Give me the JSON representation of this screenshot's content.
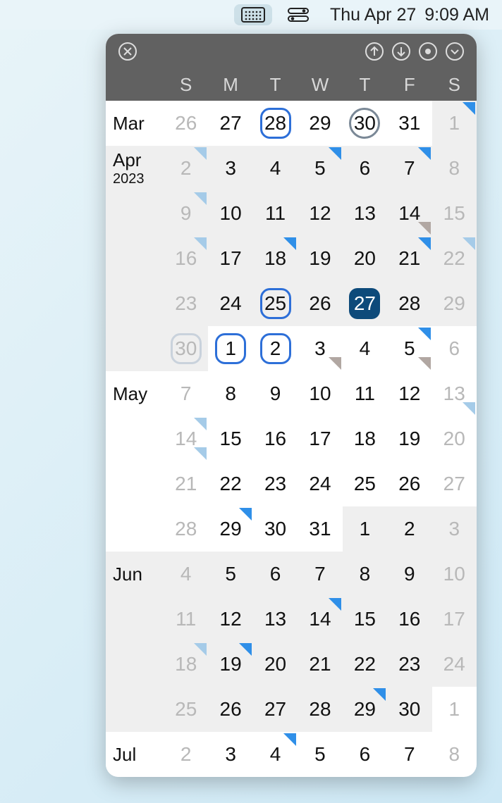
{
  "menubar": {
    "date": "Thu Apr 27",
    "time": "9:09 AM"
  },
  "dow": [
    "S",
    "M",
    "T",
    "W",
    "T",
    "F",
    "S"
  ],
  "rows": [
    {
      "month": "Mar",
      "year": "",
      "alt_month": false,
      "cells": [
        {
          "n": "26",
          "dim": true,
          "markers": []
        },
        {
          "n": "27",
          "dim": false,
          "markers": []
        },
        {
          "n": "28",
          "dim": false,
          "sel": "blue",
          "markers": []
        },
        {
          "n": "29",
          "dim": false,
          "markers": []
        },
        {
          "n": "30",
          "dim": false,
          "sel": "gray",
          "markers": []
        },
        {
          "n": "31",
          "dim": false,
          "markers": []
        },
        {
          "n": "1",
          "dim": true,
          "alt": true,
          "markers": [
            "blue"
          ]
        }
      ]
    },
    {
      "month": "Apr",
      "year": "2023",
      "alt_month": true,
      "cells": [
        {
          "n": "2",
          "dim": true,
          "alt": true,
          "markers": [
            "light"
          ]
        },
        {
          "n": "3",
          "dim": false,
          "alt": true,
          "markers": []
        },
        {
          "n": "4",
          "dim": false,
          "alt": true,
          "markers": []
        },
        {
          "n": "5",
          "dim": false,
          "alt": true,
          "markers": [
            "blue"
          ]
        },
        {
          "n": "6",
          "dim": false,
          "alt": true,
          "markers": []
        },
        {
          "n": "7",
          "dim": false,
          "alt": true,
          "markers": [
            "blue"
          ]
        },
        {
          "n": "8",
          "dim": true,
          "alt": true,
          "markers": []
        }
      ]
    },
    {
      "month": "",
      "year": "",
      "alt_month": true,
      "cells": [
        {
          "n": "9",
          "dim": true,
          "alt": true,
          "markers": [
            "light"
          ]
        },
        {
          "n": "10",
          "dim": false,
          "alt": true,
          "markers": []
        },
        {
          "n": "11",
          "dim": false,
          "alt": true,
          "markers": []
        },
        {
          "n": "12",
          "dim": false,
          "alt": true,
          "markers": []
        },
        {
          "n": "13",
          "dim": false,
          "alt": true,
          "markers": []
        },
        {
          "n": "14",
          "dim": false,
          "alt": true,
          "markers": [],
          "br": "gray"
        },
        {
          "n": "15",
          "dim": true,
          "alt": true,
          "markers": []
        }
      ]
    },
    {
      "month": "",
      "year": "",
      "alt_month": true,
      "cells": [
        {
          "n": "16",
          "dim": true,
          "alt": true,
          "markers": [
            "light"
          ]
        },
        {
          "n": "17",
          "dim": false,
          "alt": true,
          "markers": []
        },
        {
          "n": "18",
          "dim": false,
          "alt": true,
          "markers": [
            "blue"
          ]
        },
        {
          "n": "19",
          "dim": false,
          "alt": true,
          "markers": []
        },
        {
          "n": "20",
          "dim": false,
          "alt": true,
          "markers": []
        },
        {
          "n": "21",
          "dim": false,
          "alt": true,
          "markers": [
            "blue"
          ]
        },
        {
          "n": "22",
          "dim": true,
          "alt": true,
          "markers": [
            "light"
          ]
        }
      ]
    },
    {
      "month": "",
      "year": "",
      "alt_month": true,
      "cells": [
        {
          "n": "23",
          "dim": true,
          "alt": true,
          "markers": []
        },
        {
          "n": "24",
          "dim": false,
          "alt": true,
          "markers": []
        },
        {
          "n": "25",
          "dim": false,
          "alt": true,
          "sel": "blue",
          "markers": []
        },
        {
          "n": "26",
          "dim": false,
          "alt": true,
          "markers": []
        },
        {
          "n": "27",
          "dim": false,
          "alt": true,
          "today": true,
          "markers": []
        },
        {
          "n": "28",
          "dim": false,
          "alt": true,
          "markers": []
        },
        {
          "n": "29",
          "dim": true,
          "alt": true,
          "markers": []
        }
      ]
    },
    {
      "month": "",
      "year": "",
      "alt_month": true,
      "cells": [
        {
          "n": "30",
          "dim": true,
          "alt": true,
          "sel": "light",
          "markers": []
        },
        {
          "n": "1",
          "dim": false,
          "alt": false,
          "sel": "blue",
          "markers": []
        },
        {
          "n": "2",
          "dim": false,
          "alt": false,
          "sel": "blue",
          "markers": []
        },
        {
          "n": "3",
          "dim": false,
          "alt": false,
          "markers": [],
          "br": "gray"
        },
        {
          "n": "4",
          "dim": false,
          "alt": false,
          "markers": []
        },
        {
          "n": "5",
          "dim": false,
          "alt": false,
          "markers": [
            "blue"
          ],
          "br": "gray"
        },
        {
          "n": "6",
          "dim": true,
          "alt": false,
          "markers": []
        }
      ]
    },
    {
      "month": "May",
      "year": "",
      "alt_month": false,
      "cells": [
        {
          "n": "7",
          "dim": true,
          "markers": []
        },
        {
          "n": "8",
          "dim": false,
          "markers": []
        },
        {
          "n": "9",
          "dim": false,
          "markers": []
        },
        {
          "n": "10",
          "dim": false,
          "markers": []
        },
        {
          "n": "11",
          "dim": false,
          "markers": []
        },
        {
          "n": "12",
          "dim": false,
          "markers": []
        },
        {
          "n": "13",
          "dim": true,
          "markers": [],
          "br": "light"
        }
      ]
    },
    {
      "month": "",
      "year": "",
      "alt_month": false,
      "cells": [
        {
          "n": "14",
          "dim": true,
          "markers": [
            "light"
          ],
          "br": "light"
        },
        {
          "n": "15",
          "dim": false,
          "markers": []
        },
        {
          "n": "16",
          "dim": false,
          "markers": []
        },
        {
          "n": "17",
          "dim": false,
          "markers": []
        },
        {
          "n": "18",
          "dim": false,
          "markers": []
        },
        {
          "n": "19",
          "dim": false,
          "markers": []
        },
        {
          "n": "20",
          "dim": true,
          "markers": []
        }
      ]
    },
    {
      "month": "",
      "year": "",
      "alt_month": false,
      "cells": [
        {
          "n": "21",
          "dim": true,
          "markers": []
        },
        {
          "n": "22",
          "dim": false,
          "markers": []
        },
        {
          "n": "23",
          "dim": false,
          "markers": []
        },
        {
          "n": "24",
          "dim": false,
          "markers": []
        },
        {
          "n": "25",
          "dim": false,
          "markers": []
        },
        {
          "n": "26",
          "dim": false,
          "markers": []
        },
        {
          "n": "27",
          "dim": true,
          "markers": []
        }
      ]
    },
    {
      "month": "",
      "year": "",
      "alt_month": false,
      "cells": [
        {
          "n": "28",
          "dim": true,
          "markers": []
        },
        {
          "n": "29",
          "dim": false,
          "markers": [
            "blue"
          ]
        },
        {
          "n": "30",
          "dim": false,
          "markers": []
        },
        {
          "n": "31",
          "dim": false,
          "markers": []
        },
        {
          "n": "1",
          "dim": false,
          "alt": true,
          "markers": []
        },
        {
          "n": "2",
          "dim": false,
          "alt": true,
          "markers": []
        },
        {
          "n": "3",
          "dim": true,
          "alt": true,
          "markers": []
        }
      ]
    },
    {
      "month": "Jun",
      "year": "",
      "alt_month": true,
      "cells": [
        {
          "n": "4",
          "dim": true,
          "alt": true,
          "markers": []
        },
        {
          "n": "5",
          "dim": false,
          "alt": true,
          "markers": []
        },
        {
          "n": "6",
          "dim": false,
          "alt": true,
          "markers": []
        },
        {
          "n": "7",
          "dim": false,
          "alt": true,
          "markers": []
        },
        {
          "n": "8",
          "dim": false,
          "alt": true,
          "markers": []
        },
        {
          "n": "9",
          "dim": false,
          "alt": true,
          "markers": []
        },
        {
          "n": "10",
          "dim": true,
          "alt": true,
          "markers": []
        }
      ]
    },
    {
      "month": "",
      "year": "",
      "alt_month": true,
      "cells": [
        {
          "n": "11",
          "dim": true,
          "alt": true,
          "markers": []
        },
        {
          "n": "12",
          "dim": false,
          "alt": true,
          "markers": []
        },
        {
          "n": "13",
          "dim": false,
          "alt": true,
          "markers": []
        },
        {
          "n": "14",
          "dim": false,
          "alt": true,
          "markers": [
            "blue"
          ]
        },
        {
          "n": "15",
          "dim": false,
          "alt": true,
          "markers": []
        },
        {
          "n": "16",
          "dim": false,
          "alt": true,
          "markers": []
        },
        {
          "n": "17",
          "dim": true,
          "alt": true,
          "markers": []
        }
      ]
    },
    {
      "month": "",
      "year": "",
      "alt_month": true,
      "cells": [
        {
          "n": "18",
          "dim": true,
          "alt": true,
          "markers": [
            "light"
          ]
        },
        {
          "n": "19",
          "dim": false,
          "alt": true,
          "markers": [
            "blue"
          ]
        },
        {
          "n": "20",
          "dim": false,
          "alt": true,
          "markers": []
        },
        {
          "n": "21",
          "dim": false,
          "alt": true,
          "markers": []
        },
        {
          "n": "22",
          "dim": false,
          "alt": true,
          "markers": []
        },
        {
          "n": "23",
          "dim": false,
          "alt": true,
          "markers": []
        },
        {
          "n": "24",
          "dim": true,
          "alt": true,
          "markers": []
        }
      ]
    },
    {
      "month": "",
      "year": "",
      "alt_month": true,
      "cells": [
        {
          "n": "25",
          "dim": true,
          "alt": true,
          "markers": []
        },
        {
          "n": "26",
          "dim": false,
          "alt": true,
          "markers": []
        },
        {
          "n": "27",
          "dim": false,
          "alt": true,
          "markers": []
        },
        {
          "n": "28",
          "dim": false,
          "alt": true,
          "markers": []
        },
        {
          "n": "29",
          "dim": false,
          "alt": true,
          "markers": [
            "blue"
          ]
        },
        {
          "n": "30",
          "dim": false,
          "alt": true,
          "markers": []
        },
        {
          "n": "1",
          "dim": true,
          "alt": false,
          "markers": []
        }
      ]
    },
    {
      "month": "Jul",
      "year": "",
      "alt_month": false,
      "cells": [
        {
          "n": "2",
          "dim": true,
          "markers": []
        },
        {
          "n": "3",
          "dim": false,
          "markers": []
        },
        {
          "n": "4",
          "dim": false,
          "markers": [
            "blue"
          ]
        },
        {
          "n": "5",
          "dim": false,
          "markers": []
        },
        {
          "n": "6",
          "dim": false,
          "markers": []
        },
        {
          "n": "7",
          "dim": false,
          "markers": []
        },
        {
          "n": "8",
          "dim": true,
          "markers": []
        }
      ]
    }
  ]
}
